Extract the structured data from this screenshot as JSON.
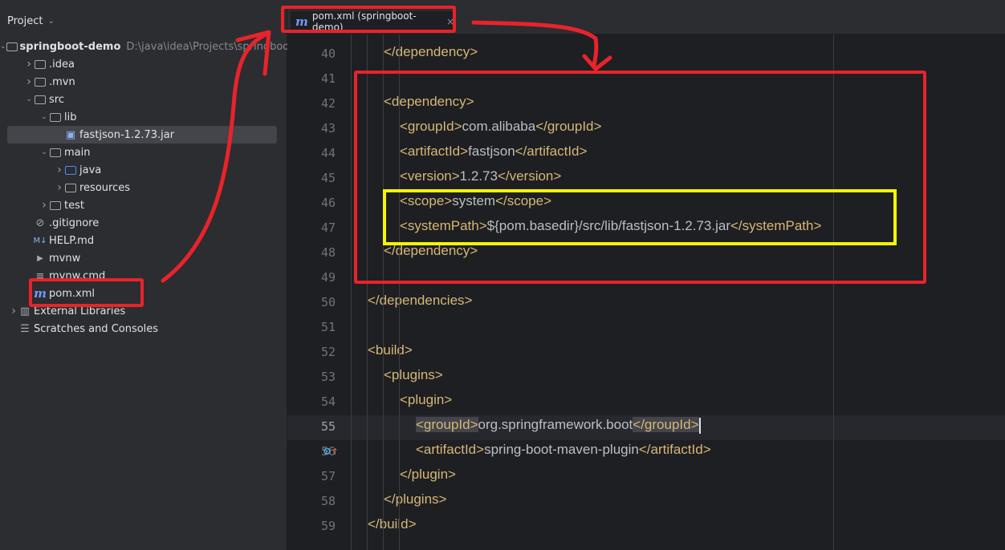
{
  "project_panel": {
    "title": "Project",
    "tree": [
      {
        "label": "springboot-demo",
        "hint": "D:\\java\\idea\\Projects\\springboot-demo",
        "icon": "module-folder-icon",
        "arrow": "down"
      },
      {
        "label": ".idea",
        "icon": "folder-icon",
        "arrow": "right"
      },
      {
        "label": ".mvn",
        "icon": "folder-icon",
        "arrow": "right"
      },
      {
        "label": "src",
        "icon": "folder-icon",
        "arrow": "down"
      },
      {
        "label": "lib",
        "icon": "folder-icon",
        "arrow": "down"
      },
      {
        "label": "fastjson-1.2.73.jar",
        "icon": "jar-icon",
        "arrow": ""
      },
      {
        "label": "main",
        "icon": "folder-icon",
        "arrow": "down"
      },
      {
        "label": "java",
        "icon": "source-folder-icon",
        "arrow": "right"
      },
      {
        "label": "resources",
        "icon": "resources-folder-icon",
        "arrow": "right"
      },
      {
        "label": "test",
        "icon": "folder-icon",
        "arrow": "right"
      },
      {
        "label": ".gitignore",
        "icon": "ignore-file-icon",
        "arrow": ""
      },
      {
        "label": "HELP.md",
        "icon": "markdown-icon",
        "arrow": ""
      },
      {
        "label": "mvnw",
        "icon": "terminal-icon",
        "arrow": ""
      },
      {
        "label": "mvnw.cmd",
        "icon": "text-file-icon",
        "arrow": ""
      },
      {
        "label": "pom.xml",
        "icon": "maven-icon",
        "arrow": ""
      },
      {
        "label": "External Libraries",
        "icon": "libraries-icon",
        "arrow": "right"
      },
      {
        "label": "Scratches and Consoles",
        "icon": "scratches-icon",
        "arrow": ""
      }
    ]
  },
  "editor_tab": {
    "label": "pom.xml (springboot-demo)",
    "close": "×"
  },
  "editor": {
    "current_line": "55",
    "lines": [
      {
        "num": "40",
        "parts": [
          [
            "tag",
            "</dependency>"
          ]
        ]
      },
      {
        "num": "41",
        "parts": []
      },
      {
        "num": "42",
        "parts": [
          [
            "tag",
            "<dependency>"
          ]
        ]
      },
      {
        "num": "43",
        "parts": [
          [
            "tag",
            "<groupId>"
          ],
          [
            "txt",
            "com.alibaba"
          ],
          [
            "tag",
            "</groupId>"
          ]
        ]
      },
      {
        "num": "44",
        "parts": [
          [
            "tag",
            "<artifactId>"
          ],
          [
            "txt",
            "fastjson"
          ],
          [
            "tag",
            "</artifactId>"
          ]
        ]
      },
      {
        "num": "45",
        "parts": [
          [
            "tag",
            "<version>"
          ],
          [
            "txt",
            "1.2.73"
          ],
          [
            "tag",
            "</version>"
          ]
        ]
      },
      {
        "num": "46",
        "parts": [
          [
            "tag",
            "<scope>"
          ],
          [
            "txt",
            "system"
          ],
          [
            "tag",
            "</scope>"
          ]
        ]
      },
      {
        "num": "47",
        "parts": [
          [
            "tag",
            "<systemPath>"
          ],
          [
            "txt",
            "${pom.basedir}/src/lib/fastjson-1.2.73.jar"
          ],
          [
            "tag",
            "</systemPath>"
          ]
        ]
      },
      {
        "num": "48",
        "parts": [
          [
            "tag",
            "</dependency>"
          ]
        ]
      },
      {
        "num": "49",
        "parts": []
      },
      {
        "num": "50",
        "parts": [
          [
            "tag",
            "</dependencies>"
          ]
        ]
      },
      {
        "num": "51",
        "parts": []
      },
      {
        "num": "52",
        "parts": [
          [
            "tag",
            "<build>"
          ]
        ]
      },
      {
        "num": "53",
        "parts": [
          [
            "tag",
            "<plugins>"
          ]
        ]
      },
      {
        "num": "54",
        "parts": [
          [
            "tag",
            "<plugin>"
          ]
        ]
      },
      {
        "num": "55",
        "parts": [
          [
            "tag hl",
            "<groupId>"
          ],
          [
            "txt",
            "org.springframework.boot"
          ],
          [
            "tag hl",
            "</groupId>"
          ]
        ]
      },
      {
        "num": "56",
        "parts": [
          [
            "tag",
            "<artifactId>"
          ],
          [
            "txt",
            "spring-boot-maven-plugin"
          ],
          [
            "tag",
            "</artifactId>"
          ]
        ]
      },
      {
        "num": "57",
        "parts": [
          [
            "tag",
            "</plugin>"
          ]
        ]
      },
      {
        "num": "58",
        "parts": [
          [
            "tag",
            "</plugins>"
          ]
        ]
      },
      {
        "num": "59",
        "parts": [
          [
            "tag",
            "</build>"
          ]
        ]
      }
    ]
  },
  "colors": {
    "annotation_red": "#e8232b",
    "annotation_yellow": "#f5f505",
    "tag": "#d5b778",
    "text": "#bcbec4"
  }
}
